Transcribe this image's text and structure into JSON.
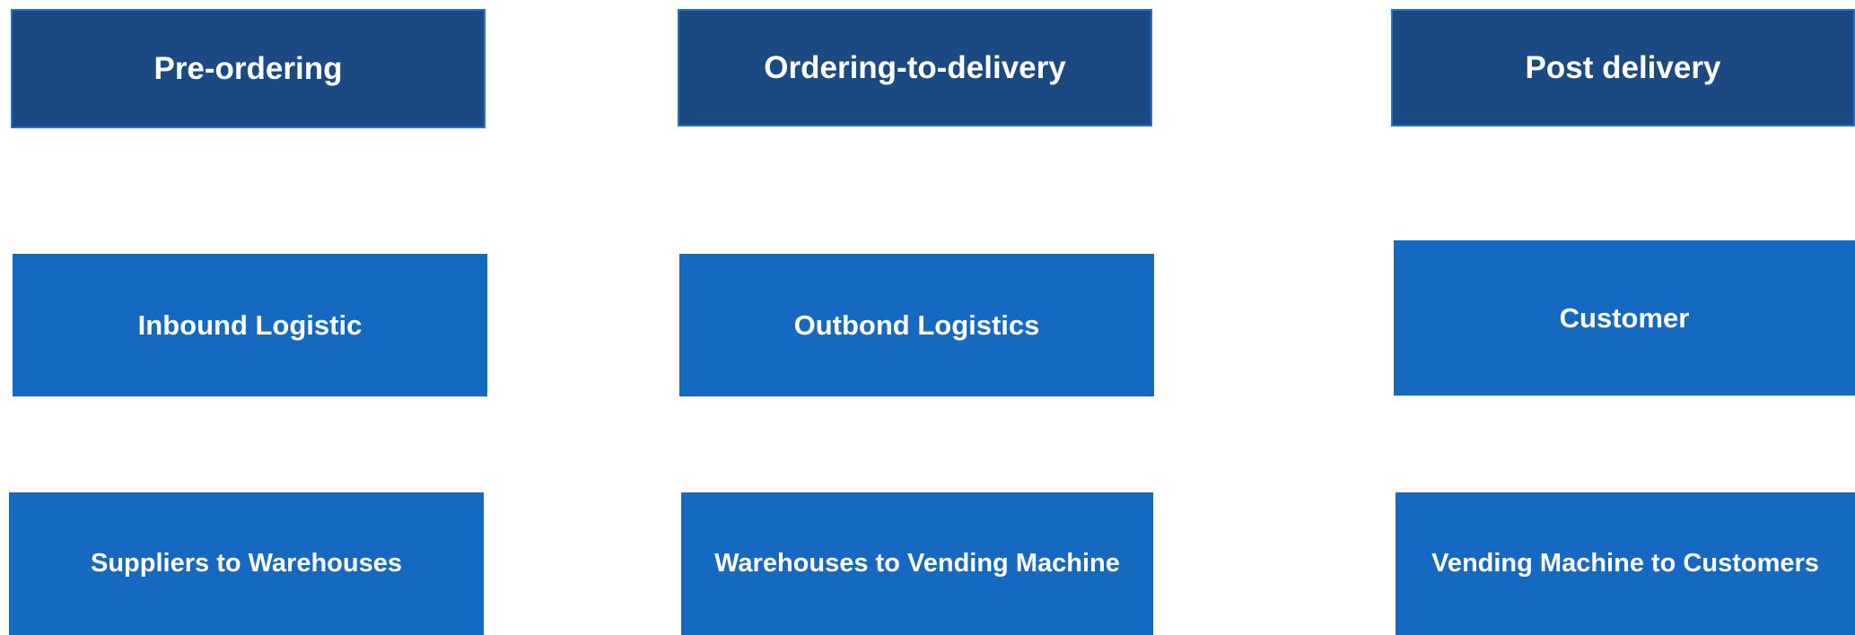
{
  "colors": {
    "header_fill": "#1b4a82",
    "header_border": "#2a6fc0",
    "box_fill": "#1569c0",
    "text": "#ffffff",
    "background": "#ffffff"
  },
  "columns": [
    {
      "header": "Pre-ordering",
      "category": "Inbound Logistic",
      "flow": "Suppliers to Warehouses"
    },
    {
      "header": "Ordering-to-delivery",
      "category": "Outbond Logistics",
      "flow": "Warehouses to Vending Machine"
    },
    {
      "header": "Post delivery",
      "category": "Customer",
      "flow": "Vending Machine to Customers"
    }
  ]
}
